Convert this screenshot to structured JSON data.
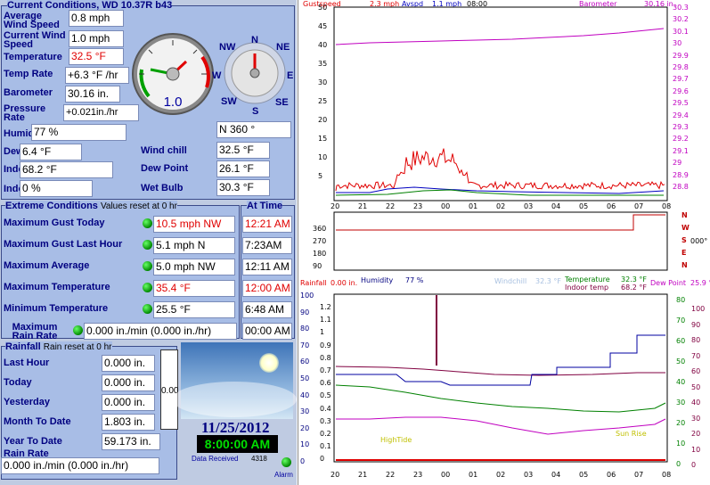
{
  "current": {
    "title": "Current Conditions, WD 10.37R b43",
    "avg_wind_label": "Average Wind Speed",
    "avg_wind": "0.8 mph",
    "cur_wind_label": "Current Wind Speed",
    "cur_wind": "1.0 mph",
    "temp_label": "Temperature",
    "temp": "32.5 °F",
    "temprate_label": "Temp Rate",
    "temprate": "+6.3 °F /hr",
    "baro_label": "Barometer",
    "baro": "30.16 in.",
    "pressrate_label": "Pressure Rate",
    "pressrate": "+0.021in./hr",
    "humidity_label": "Humidity",
    "humidity": "77 %",
    "dewpt_label": "Dew Pt Depr.",
    "dewpt": "6.4 °F",
    "windchill_label": "Wind chill",
    "windchill": "32.5 °F",
    "indoortemp_label": "Indoor Temp.",
    "indoortemp": "68.2 °F",
    "dewpoint_label": "Dew Point",
    "dewpoint": "26.1 °F",
    "indoorhum_label": "Indoor Hum.",
    "indoorhum": "0 %",
    "wetbulb_label": "Wet Bulb",
    "wetbulb": "30.3 °F",
    "gauge_value": "1.0",
    "direction": "N  360 °",
    "compass": {
      "n": "N",
      "ne": "NE",
      "e": "E",
      "se": "SE",
      "s": "S",
      "sw": "SW",
      "w": "W",
      "nw": "NW"
    }
  },
  "extremes": {
    "title": "Extreme Conditions",
    "subtitle": "Values reset at 0 hr",
    "attime": "At Time",
    "rows": [
      {
        "label": "Maximum Gust Today",
        "value": "10.5 mph NW",
        "time": "12:21 AM",
        "red": true
      },
      {
        "label": "Maximum Gust Last Hour",
        "value": "5.1 mph  N",
        "time": "7:23AM",
        "red": false
      },
      {
        "label": "Maximum Average",
        "value": "5.0 mph NW",
        "time": "12:11 AM",
        "red": false
      },
      {
        "label": "Maximum Temperature",
        "value": "35.4 °F",
        "time": "12:00 AM",
        "red": true
      },
      {
        "label": "Minimum Temperature",
        "value": "25.5 °F",
        "time": "6:48 AM",
        "red": false
      },
      {
        "label": "Maximum Rain Rate",
        "value": "0.000 in./min (0.000 in./hr)",
        "time": "00:00 AM",
        "red": false
      }
    ]
  },
  "rainfall": {
    "title": "Rainfall",
    "subtitle": "Rain reset at 0 hr",
    "lasthour_label": "Last Hour",
    "lasthour": "0.000 in.",
    "today_label": "Today",
    "today": "0.000 in.",
    "yesterday_label": "Yesterday",
    "yesterday": "0.000 in.",
    "month_label": "Month To Date",
    "month": "1.803 in.",
    "year_label": "Year To Date",
    "year": "59.173 in.",
    "rate_label": "Rain Rate",
    "rate": "0.000 in./min (0.000 in./hr)",
    "gauge": "0.00"
  },
  "status": {
    "date": "11/25/2012",
    "time": "8:00:00 AM",
    "data_received_label": "Data Received",
    "data_received": "4318",
    "alarm": "Alarm"
  },
  "graph_top": {
    "gustspeed_label": "Gustspeed",
    "gustspeed": "2.3 mph",
    "avspd_label": "Avspd",
    "avspd": "1.1 mph",
    "time": "08:00",
    "baro_label": "Barometer",
    "baro": "30.16 in.",
    "left_ticks": [
      "50",
      "45",
      "40",
      "35",
      "30",
      "25",
      "20",
      "15",
      "10",
      "5"
    ],
    "right_ticks": [
      "30.3",
      "30.2",
      "30.1",
      "30",
      "29.9",
      "29.8",
      "29.7",
      "29.6",
      "29.5",
      "29.4",
      "29.3",
      "29.2",
      "29.1",
      "29",
      "28.9",
      "28.8"
    ],
    "x_ticks": [
      "20",
      "21",
      "22",
      "23",
      "00",
      "01",
      "02",
      "03",
      "04",
      "05",
      "06",
      "07",
      "08"
    ]
  },
  "graph_dir": {
    "left_ticks": [
      "360",
      "270",
      "180",
      "90"
    ],
    "compass": [
      "N",
      "W",
      "S",
      "E",
      "N"
    ],
    "value": "000°"
  },
  "graph_bottom": {
    "rainfall_label": "Rainfall",
    "rainfall": "0.00 in.",
    "humidity_label": "Humidity",
    "humidity": "77 %",
    "windchill_label": "Windchill",
    "windchill": "32.3 °F",
    "temp_label": "Temperature",
    "temp": "32.3 °F",
    "indoor_label": "Indoor temp",
    "indoor": "68.2 °F",
    "dewpoint_label": "Dew Point",
    "dewpoint": "25.9 °",
    "hum_ticks": [
      "100",
      "90",
      "80",
      "70",
      "60",
      "50",
      "40",
      "30",
      "20",
      "10",
      "0"
    ],
    "rain_ticks": [
      "1.2",
      "1.1",
      "1",
      "0.9",
      "0.8",
      "0.7",
      "0.6",
      "0.5",
      "0.4",
      "0.3",
      "0.2",
      "0.1",
      "0"
    ],
    "temp_ticks": [
      "80",
      "70",
      "60",
      "50",
      "40",
      "30",
      "20",
      "10",
      "0"
    ],
    "indoor_ticks": [
      "100",
      "90",
      "80",
      "70",
      "60",
      "50",
      "40",
      "30",
      "20",
      "10",
      "0"
    ],
    "x_ticks": [
      "20",
      "21",
      "22",
      "23",
      "00",
      "01",
      "02",
      "03",
      "04",
      "05",
      "06",
      "07",
      "08"
    ],
    "hightide": "HighTide",
    "sunrise": "Sun Rise"
  },
  "colors": {
    "gust": "#e00000",
    "avg": "#0000c0",
    "baro": "#c000c0",
    "humidity": "#000080",
    "temp": "#008000",
    "indoor": "#800040",
    "dew": "#c000c0"
  }
}
